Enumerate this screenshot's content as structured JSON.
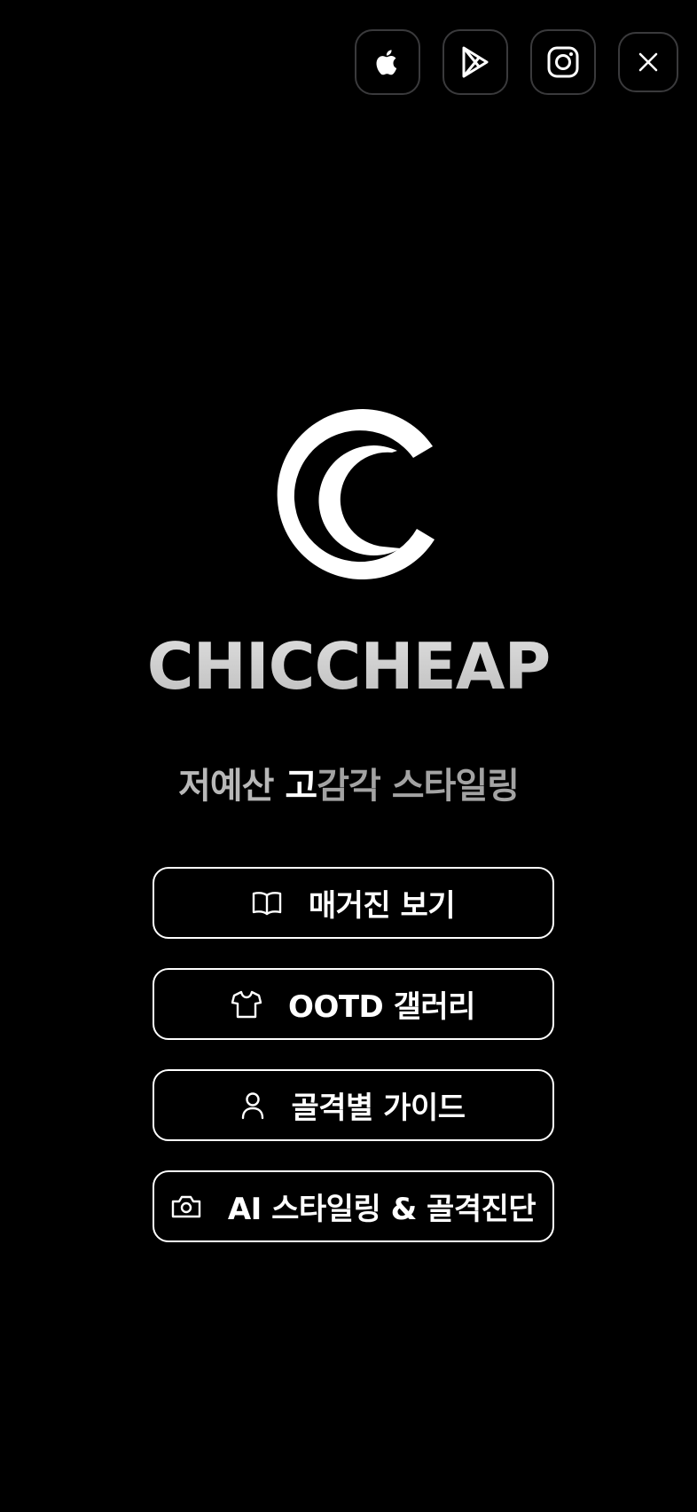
{
  "top_actions": {
    "apple_label": "App Store",
    "play_label": "Google Play",
    "instagram_label": "Instagram",
    "close_label": "Close"
  },
  "brand": {
    "name": "CHICCHEAP",
    "tagline_part1": "저예산",
    "tagline_part2": " 고",
    "tagline_part3": "감각 스타일링"
  },
  "menu": [
    {
      "icon": "book-icon",
      "label": "매거진 보기"
    },
    {
      "icon": "tshirt-icon",
      "label": "OOTD 갤러리"
    },
    {
      "icon": "user-icon",
      "label": "골격별 가이드"
    },
    {
      "icon": "camera-icon",
      "label": "AI 스타일링 & 골격진단"
    }
  ],
  "colors": {
    "background": "#000000",
    "button_border": "#ffffff",
    "top_button_border": "#3a3a3c",
    "brand_text": "#cfcfcf"
  }
}
